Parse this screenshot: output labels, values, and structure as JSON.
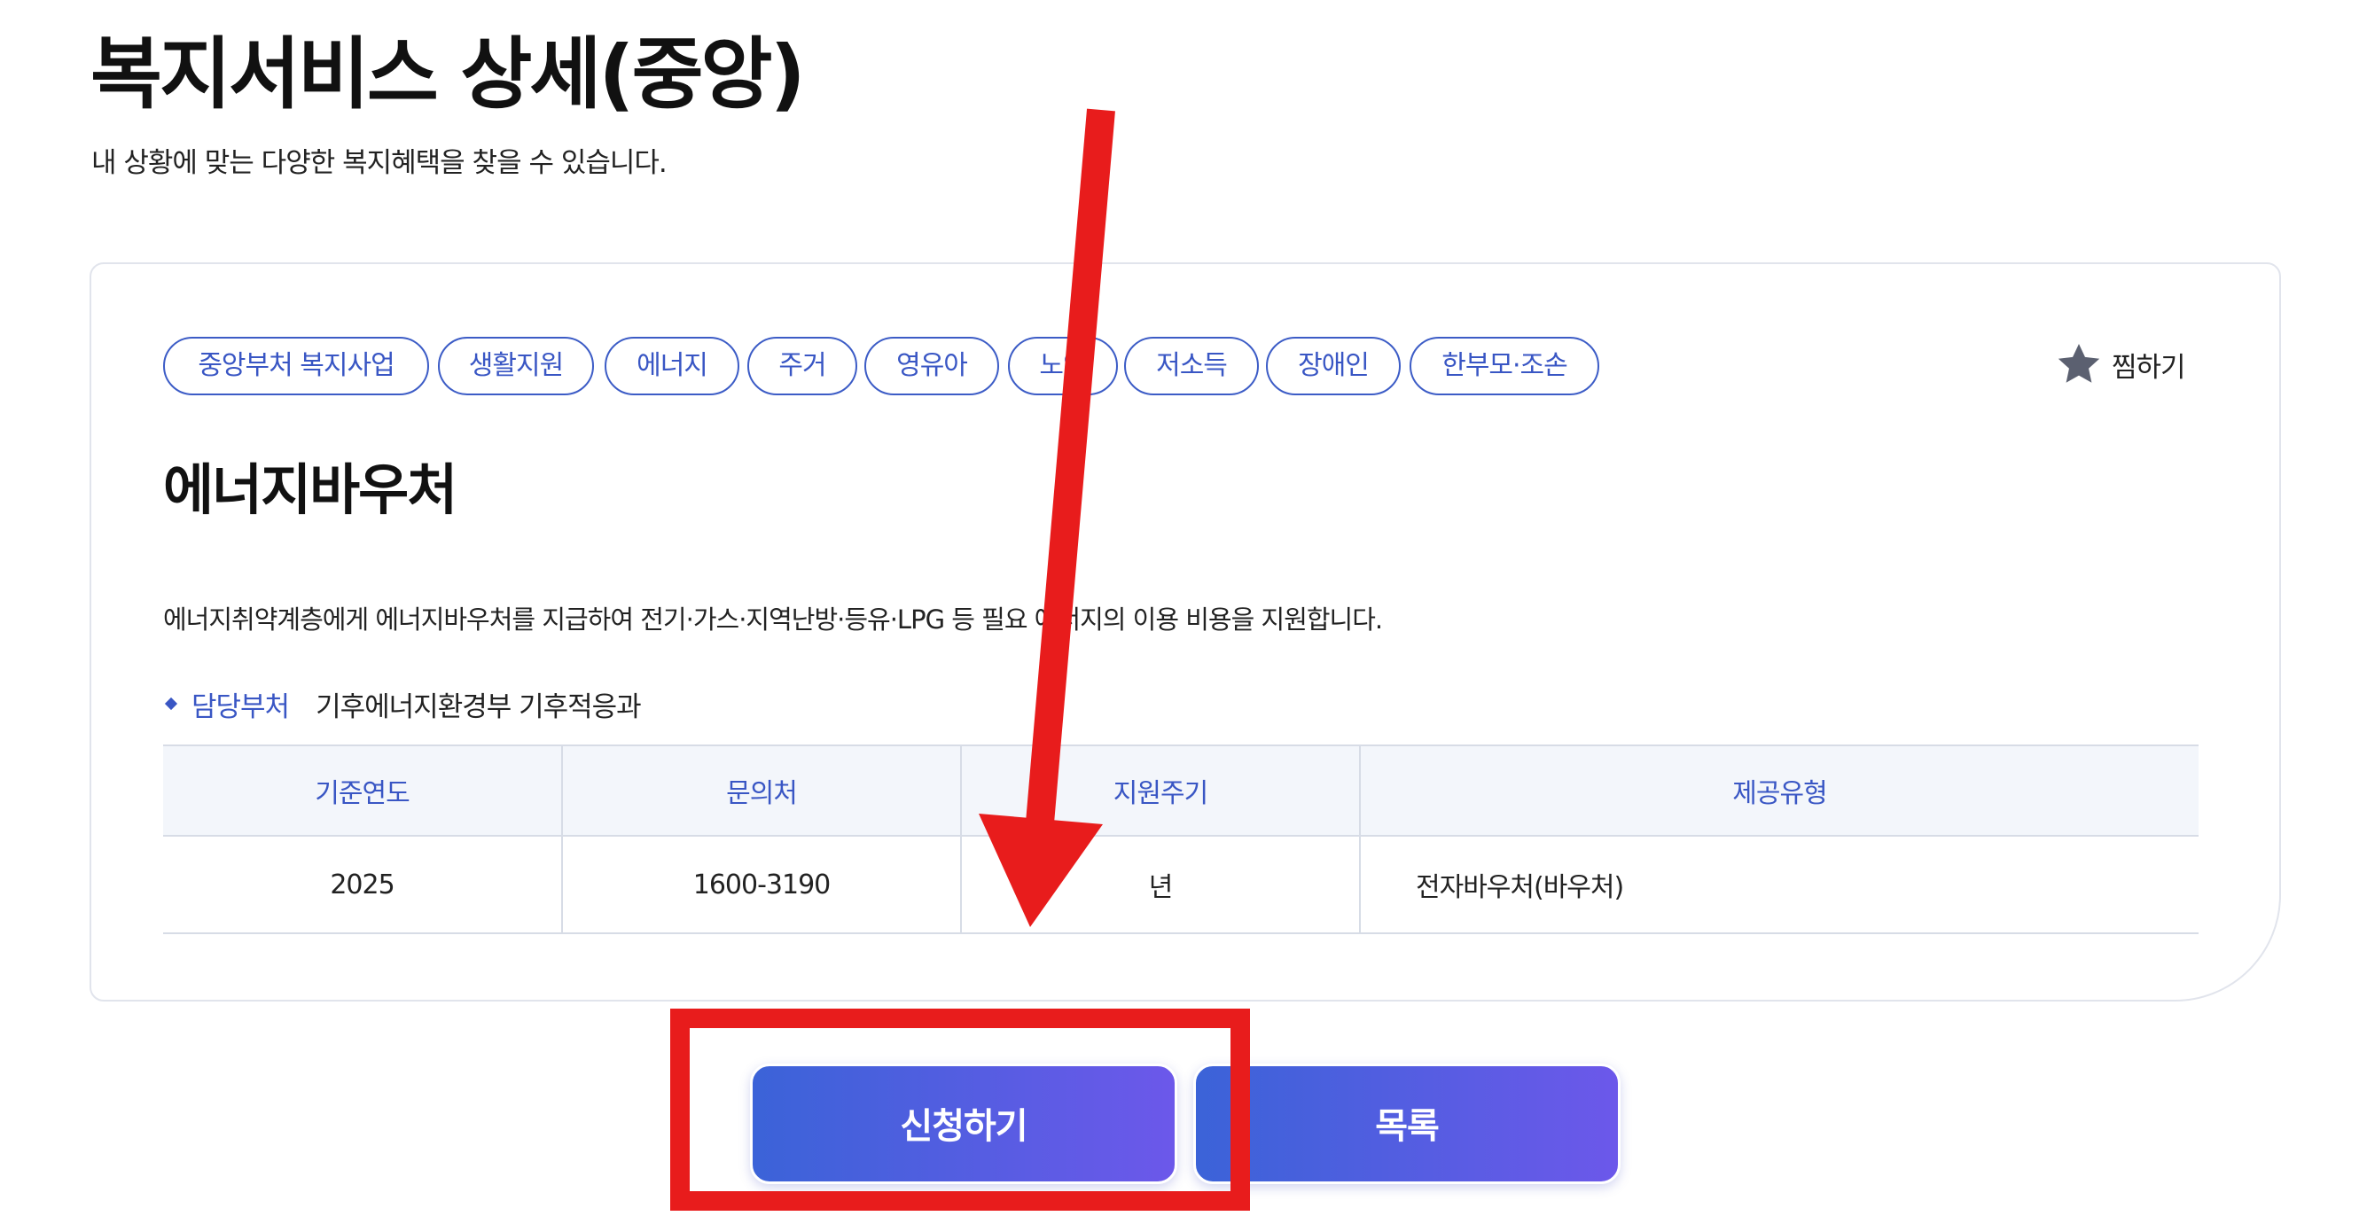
{
  "header": {
    "title": "복지서비스 상세(중앙)",
    "subtitle": "내 상황에 맞는 다양한 복지혜택을 찾을 수 있습니다."
  },
  "tags": [
    "중앙부처 복지사업",
    "생활지원",
    "에너지",
    "주거",
    "영유아",
    "노인",
    "저소득",
    "장애인",
    "한부모·조손"
  ],
  "favorite": {
    "label": "찜하기",
    "icon": "star-icon"
  },
  "service": {
    "title": "에너지바우처",
    "description": "에너지취약계층에게 에너지바우처를 지급하여 전기·가스·지역난방·등유·LPG 등 필요 에너지의 이용 비용을 지원합니다.",
    "department_label": "담당부처",
    "department_value": "기후에너지환경부 기후적응과"
  },
  "table": {
    "headers": [
      "기준연도",
      "문의처",
      "지원주기",
      "제공유형"
    ],
    "row": [
      "2025",
      "1600-3190",
      "년",
      "전자바우처(바우처)"
    ]
  },
  "actions": {
    "apply_label": "신청하기",
    "list_label": "목록"
  },
  "colors": {
    "accent": "#3956c4",
    "button_gradient_start": "#3b63d8",
    "button_gradient_end": "#6c58ea",
    "annotation_red": "#e81c1c"
  }
}
